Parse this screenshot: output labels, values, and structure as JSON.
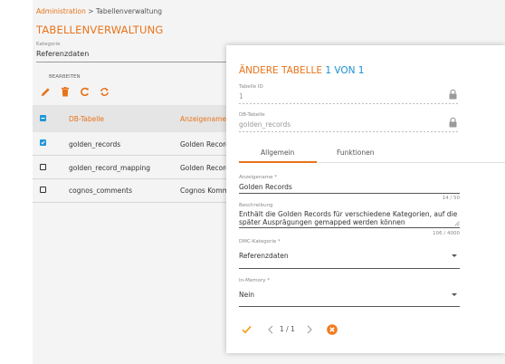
{
  "breadcrumb": {
    "root": "Administration",
    "separator": ">",
    "current": "Tabellenverwaltung"
  },
  "page_title": "TABELLENVERWALTUNG",
  "kategorie": {
    "label": "Kategorie",
    "value": "Referenzdaten"
  },
  "toolbar": {
    "label": "BEARBEITEN",
    "icons": [
      "pencil-icon",
      "trash-icon",
      "refresh-icon",
      "sync-icon"
    ]
  },
  "table": {
    "headers": [
      "DB-Tabelle",
      "Anzeigename"
    ],
    "rows": [
      {
        "checked": true,
        "db": "golden_records",
        "name": "Golden Records"
      },
      {
        "checked": false,
        "db": "golden_record_mapping",
        "name": "Golden Records Mapping"
      },
      {
        "checked": false,
        "db": "cognos_comments",
        "name": "Cognos Kommentare"
      }
    ]
  },
  "modal": {
    "title": "ÄNDERE TABELLE",
    "count": "1 VON 1",
    "tabelle_id": {
      "label": "Tabelle ID",
      "value": "1"
    },
    "db_tabelle": {
      "label": "DB-Tabelle",
      "value": "golden_records"
    },
    "tabs": [
      "Allgemein",
      "Funktionen"
    ],
    "anzeigename": {
      "label": "Anzeigename *",
      "value": "Golden Records",
      "counter": "14 / 50"
    },
    "beschreibung": {
      "label": "Beschreibung",
      "value": "Enthält die Golden Records für verschiedene Kategorien, auf die später Ausprägungen gemapped werden können",
      "counter": "106 / 4000"
    },
    "dmc_kategorie": {
      "label": "DMC-Kategorie *",
      "value": "Referenzdaten"
    },
    "in_memory": {
      "label": "In-Memory *",
      "value": "Nein"
    },
    "footer": {
      "pager": "1 / 1"
    }
  },
  "colors": {
    "accent": "#e8731a",
    "blue": "#1a8fd0",
    "checkbox": "#2196d6"
  }
}
